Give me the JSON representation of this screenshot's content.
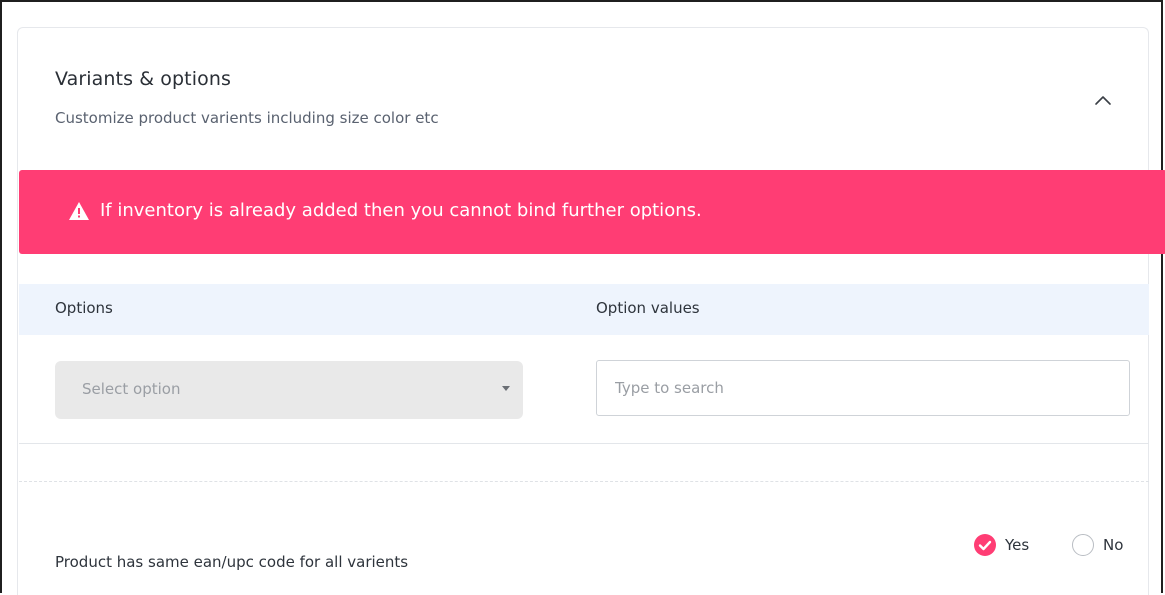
{
  "section": {
    "title": "Variants & options",
    "subtitle": "Customize product varients including size color etc"
  },
  "alert": {
    "message": "If inventory is already added then you cannot bind further options."
  },
  "table": {
    "headers": {
      "options": "Options",
      "option_values": "Option values"
    }
  },
  "options_select": {
    "placeholder": "Select option"
  },
  "values_search": {
    "placeholder": "Type to search",
    "value": ""
  },
  "ean_setting": {
    "label": "Product has same ean/upc code for all varients",
    "options": [
      {
        "label": "Yes",
        "selected": true
      },
      {
        "label": "No",
        "selected": false
      }
    ]
  },
  "icons": {
    "collapse": "chevron-up-icon",
    "alert": "warning-triangle-icon",
    "dropdown": "caret-down-icon",
    "radio_checked": "check-circle-icon"
  },
  "colors": {
    "accent": "#ff3d74",
    "table_header_bg": "#eef4fd",
    "select_bg": "#e9e9e9"
  }
}
